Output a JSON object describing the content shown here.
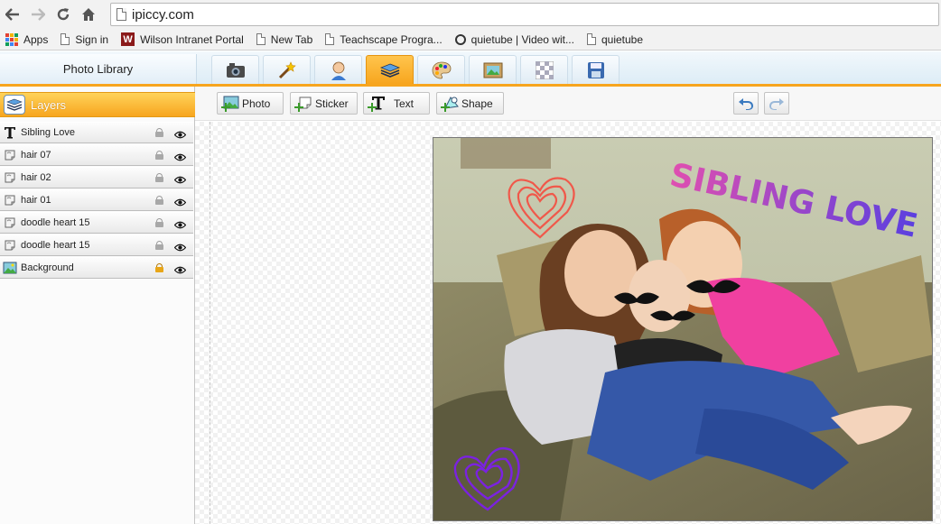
{
  "browser": {
    "url": "ipiccy.com",
    "bookmarks": [
      {
        "label": "Apps"
      },
      {
        "label": "Sign in"
      },
      {
        "label": "Wilson Intranet Portal"
      },
      {
        "label": "New Tab"
      },
      {
        "label": "Teachscape Progra..."
      },
      {
        "label": "quietube | Video wit..."
      },
      {
        "label": "quietube"
      }
    ]
  },
  "app": {
    "photo_library_label": "Photo Library",
    "top_tabs": [
      {
        "icon": "camera-icon"
      },
      {
        "icon": "magic-wand-icon"
      },
      {
        "icon": "person-icon"
      },
      {
        "icon": "layers-icon",
        "active": true
      },
      {
        "icon": "palette-icon"
      },
      {
        "icon": "frame-icon"
      },
      {
        "icon": "checker-icon"
      },
      {
        "icon": "save-icon"
      }
    ],
    "layers_title": "Layers",
    "layers": [
      {
        "label": "Sibling Love",
        "icon": "text-icon",
        "locked": false
      },
      {
        "label": "hair 07",
        "icon": "sticker-icon",
        "locked": false
      },
      {
        "label": "hair 02",
        "icon": "sticker-icon",
        "locked": false
      },
      {
        "label": "hair 01",
        "icon": "sticker-icon",
        "locked": false
      },
      {
        "label": "doodle heart 15",
        "icon": "sticker-icon",
        "locked": false
      },
      {
        "label": "doodle heart 15",
        "icon": "sticker-icon",
        "locked": false
      },
      {
        "label": "Background",
        "icon": "image-icon",
        "locked": true
      }
    ],
    "toolbar": {
      "photo_label": "Photo",
      "sticker_label": "Sticker",
      "text_label": "Text",
      "shape_label": "Shape"
    },
    "canvas": {
      "overlay_text": "SIBLING LOVE",
      "colors": {
        "heart_top": "#f0584a",
        "heart_bottom": "#7b22e0",
        "text_start": "#e04fb0",
        "text_end": "#5a3fe0",
        "accent": "#f7a51e"
      }
    }
  }
}
